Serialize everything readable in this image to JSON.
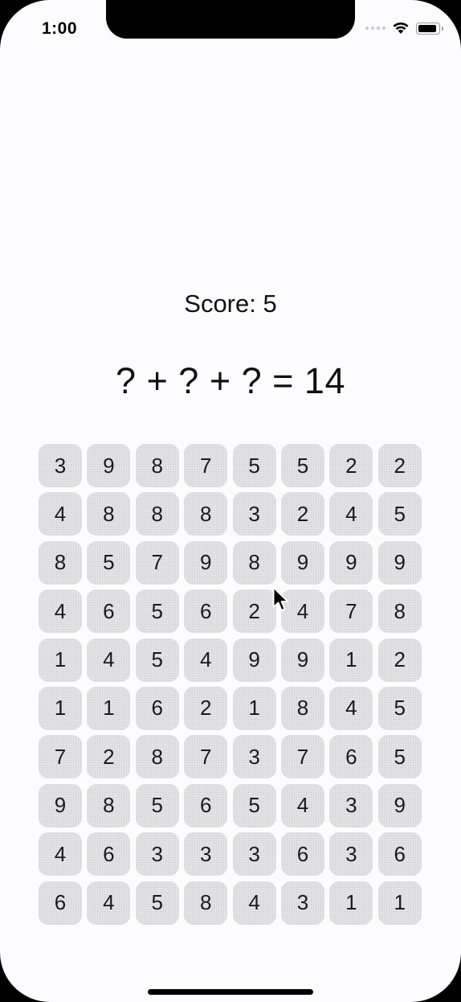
{
  "status_bar": {
    "time": "1:00",
    "icons": [
      "cellular-signal-icon",
      "wifi-icon",
      "battery-icon"
    ]
  },
  "score_label": "Score: 5",
  "equation": "? + ? + ? = 14",
  "grid": [
    [
      "3",
      "9",
      "8",
      "7",
      "5",
      "5",
      "2",
      "2"
    ],
    [
      "4",
      "8",
      "8",
      "8",
      "3",
      "2",
      "4",
      "5"
    ],
    [
      "8",
      "5",
      "7",
      "9",
      "8",
      "9",
      "9",
      "9"
    ],
    [
      "4",
      "6",
      "5",
      "6",
      "2",
      "4",
      "7",
      "8"
    ],
    [
      "1",
      "4",
      "5",
      "4",
      "9",
      "9",
      "1",
      "2"
    ],
    [
      "1",
      "1",
      "6",
      "2",
      "1",
      "8",
      "4",
      "5"
    ],
    [
      "7",
      "2",
      "8",
      "7",
      "3",
      "7",
      "6",
      "5"
    ],
    [
      "9",
      "8",
      "5",
      "6",
      "5",
      "4",
      "3",
      "9"
    ],
    [
      "4",
      "6",
      "3",
      "3",
      "3",
      "6",
      "3",
      "6"
    ],
    [
      "6",
      "4",
      "5",
      "8",
      "4",
      "3",
      "1",
      "1"
    ]
  ],
  "colors": {
    "background": "#fcfcfe",
    "tile": "#e4e4e6",
    "text": "#111111"
  }
}
